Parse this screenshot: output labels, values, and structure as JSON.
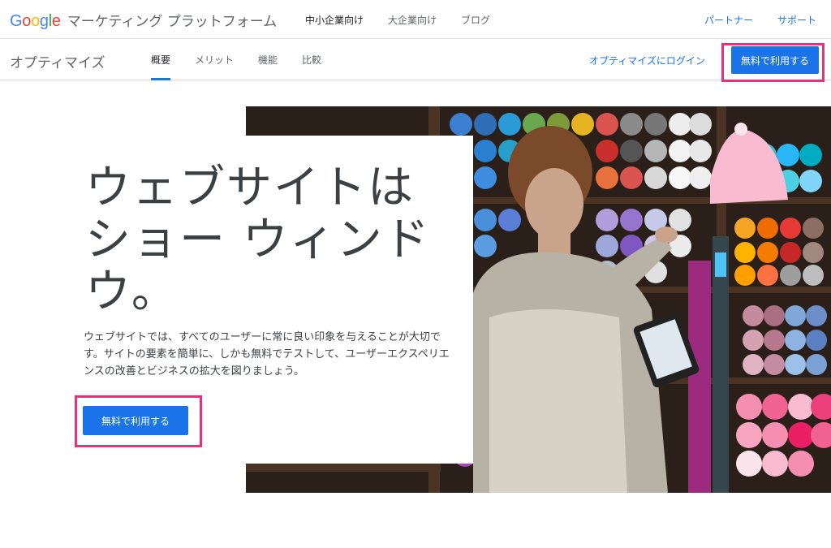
{
  "brand": {
    "logo_letters": [
      "G",
      "o",
      "o",
      "g",
      "l",
      "e"
    ],
    "logo_colors": [
      "#4285F4",
      "#EA4335",
      "#FBBC05",
      "#4285F4",
      "#34A853",
      "#EA4335"
    ],
    "title": "マーケティング プラットフォーム"
  },
  "top_nav": {
    "items": [
      {
        "label": "中小企業向け",
        "active": true
      },
      {
        "label": "大企業向け",
        "active": false
      },
      {
        "label": "ブログ",
        "active": false
      }
    ],
    "right_links": [
      {
        "label": "パートナー"
      },
      {
        "label": "サポート"
      }
    ]
  },
  "sub_nav": {
    "product": "オプティマイズ",
    "tabs": [
      {
        "label": "概要",
        "active": true
      },
      {
        "label": "メリット",
        "active": false
      },
      {
        "label": "機能",
        "active": false
      },
      {
        "label": "比較",
        "active": false
      }
    ],
    "login_label": "オプティマイズにログイン",
    "cta_label": "無料で利用する"
  },
  "hero": {
    "headline_lines": [
      "ウェブサイトは",
      "ショー ウィンド",
      "ウ。"
    ],
    "description": "ウェブサイトでは、すべてのユーザーに常に良い印象を与えることが大切です。サイトの要素を簡単に、しかも無料でテストして、ユーザーエクスペリエンスの改善とビジネスの拡大を図りましょう。",
    "cta_label": "無料で利用する"
  },
  "colors": {
    "accent": "#1a73e8",
    "highlight_frame": "#e8317b"
  }
}
